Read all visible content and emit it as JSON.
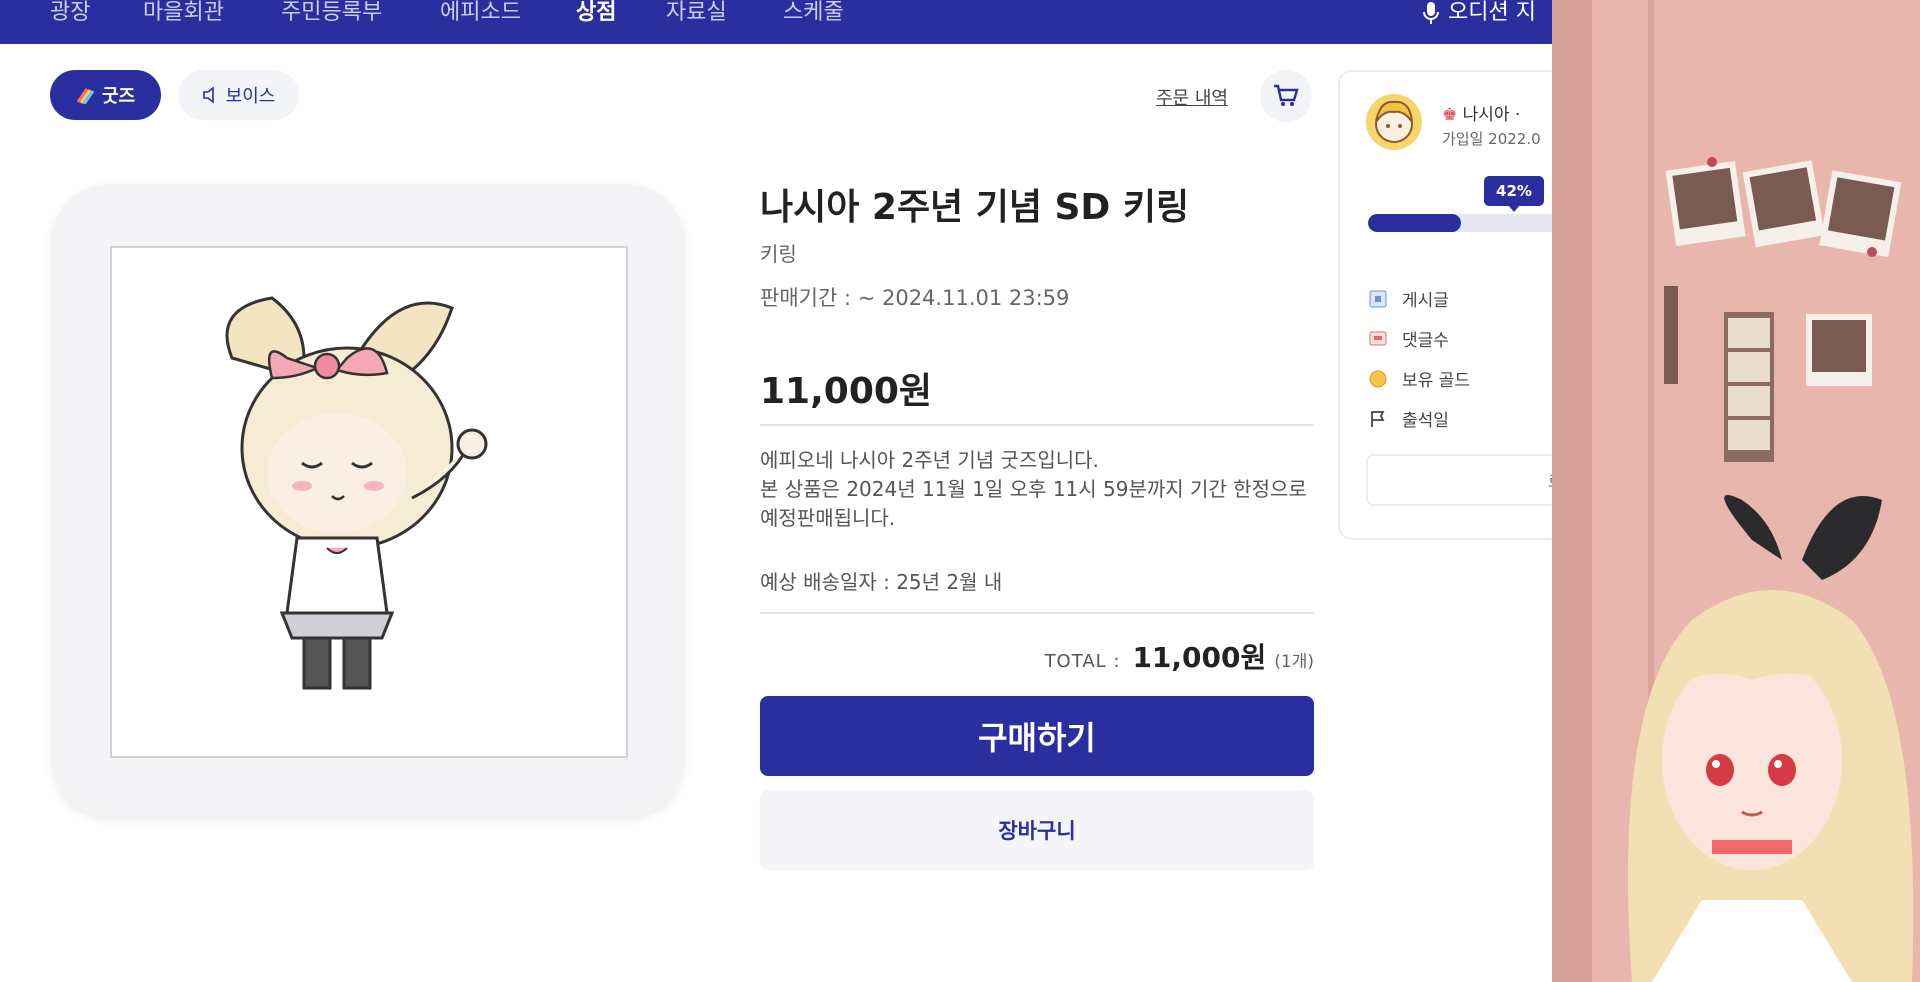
{
  "nav": {
    "items": [
      {
        "label": "광장",
        "active": false
      },
      {
        "label": "마을회관",
        "active": false
      },
      {
        "label": "주민등록부",
        "active": false
      },
      {
        "label": "에피소드",
        "active": false
      },
      {
        "label": "상점",
        "active": true
      },
      {
        "label": "자료실",
        "active": false
      },
      {
        "label": "스케줄",
        "active": false
      }
    ],
    "audio_label": "오디션 지"
  },
  "categories": {
    "goods": "굿즈",
    "voice": "보이스"
  },
  "order_history": "주문 내역",
  "product": {
    "title": "나시아 2주년 기념 SD 키링",
    "category": "키링",
    "sale_period": "판매기간 : ~ 2024.11.01 23:59",
    "price": "11,000원",
    "description": "에피오네 나시아 2주년 기념 굿즈입니다.\n본 상품은 2024년 11월 1일 오후 11시 59분까지 기간 한정으로 예정판매됩니다.",
    "shipping": "예상 배송일자 : 25년 2월 내",
    "total_label": "TOTAL :",
    "total_price": "11,000원",
    "total_qty": "(1개)",
    "buy_label": "구매하기",
    "cart_label": "장바구니"
  },
  "profile": {
    "name": "나시아 ·",
    "join": "가입일 2022.0",
    "level_percent": 42,
    "level_label": "42%",
    "stats": [
      {
        "icon": "post-icon",
        "label": "게시글"
      },
      {
        "icon": "comment-icon",
        "label": "댓글수"
      },
      {
        "icon": "gold-coin-icon",
        "label": "보유 골드"
      },
      {
        "icon": "flag-icon",
        "label": "출석일"
      }
    ],
    "login_label": "로그아"
  },
  "colors": {
    "brand": "#2b2e9e",
    "nav_bg": "#2b2e9e",
    "room_wall": "#e8b4ad"
  }
}
